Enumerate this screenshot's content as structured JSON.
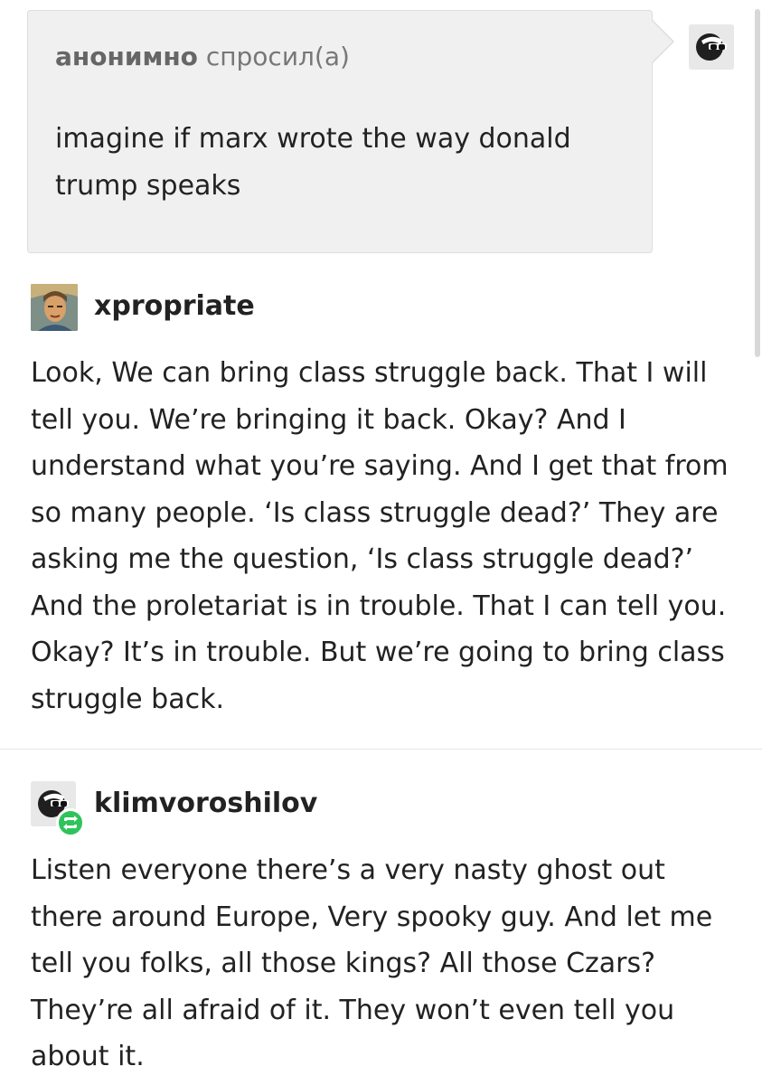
{
  "ask": {
    "asker": "анонимно",
    "verb": "спросил(а)",
    "question": "imagine if marx wrote the way donald trump speaks"
  },
  "posts": [
    {
      "username": "xpropriate",
      "text": "Look, We can bring class struggle back. That I will tell you. We’re bringing it back. Okay? And I understand what you’re saying. And I get that from so many people. ‘Is class struggle dead?’ They are asking me the question, ‘Is class struggle dead?’ And the proletariat is in trouble. That I can tell you. Okay? It’s in trouble. But we’re going to bring class struggle back."
    },
    {
      "username": "klimvoroshilov",
      "text": "Listen everyone there’s a very nasty ghost out there around Europe, Very spooky guy. And let me tell you folks, all those kings? All those Czars? They’re all afraid of it. They won’t even tell you about it."
    }
  ],
  "icons": {
    "answerer_avatar": "sunglasses-face-icon",
    "xpropriate_avatar": "portrait-avatar",
    "klimvoroshilov_avatar": "sunglasses-face-icon",
    "reblog_badge": "reblog-icon"
  },
  "colors": {
    "ask_background": "#f0f0f0",
    "reblog_green": "#2ec45b",
    "text": "#222222"
  }
}
